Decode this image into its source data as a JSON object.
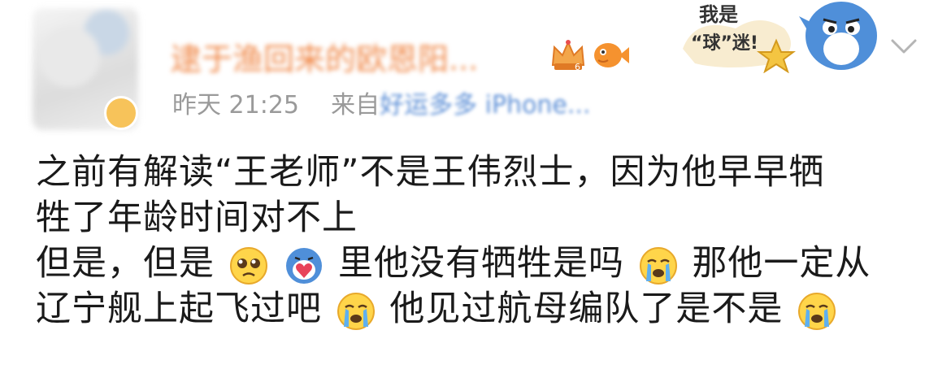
{
  "header": {
    "username": "逮于渔回来的欧恩阳...",
    "vip_level": "6",
    "timestamp": "昨天 21:25",
    "source_prefix": "来自",
    "source_name": "好运多多 iPhone..."
  },
  "sticker": {
    "text_line1": "我是",
    "text_line2": "“球”迷!"
  },
  "post": {
    "line1": "之前有解读“王老师”不是王伟烈士，因为他早早牺",
    "line2": "牲了年龄时间对不上",
    "line3_a": "但是，但是",
    "line3_b": "里他没有牺牲是吗",
    "line3_c": "那他一定从",
    "line4_a": "辽宁舰上起飞过吧",
    "line4_b": "他见过航母编队了是不是"
  },
  "icons": {
    "crown": "crown-badge-icon",
    "fish": "fish-badge-icon",
    "chevron": "chevron-down-icon",
    "emoji_sad": "pleading-face-icon",
    "emoji_heart": "heart-hug-icon",
    "emoji_cry": "crying-face-icon"
  },
  "colors": {
    "username": "#f08a4b",
    "meta": "#9a9a9a",
    "source": "#5b8ed6",
    "text": "#1a1a1a"
  }
}
